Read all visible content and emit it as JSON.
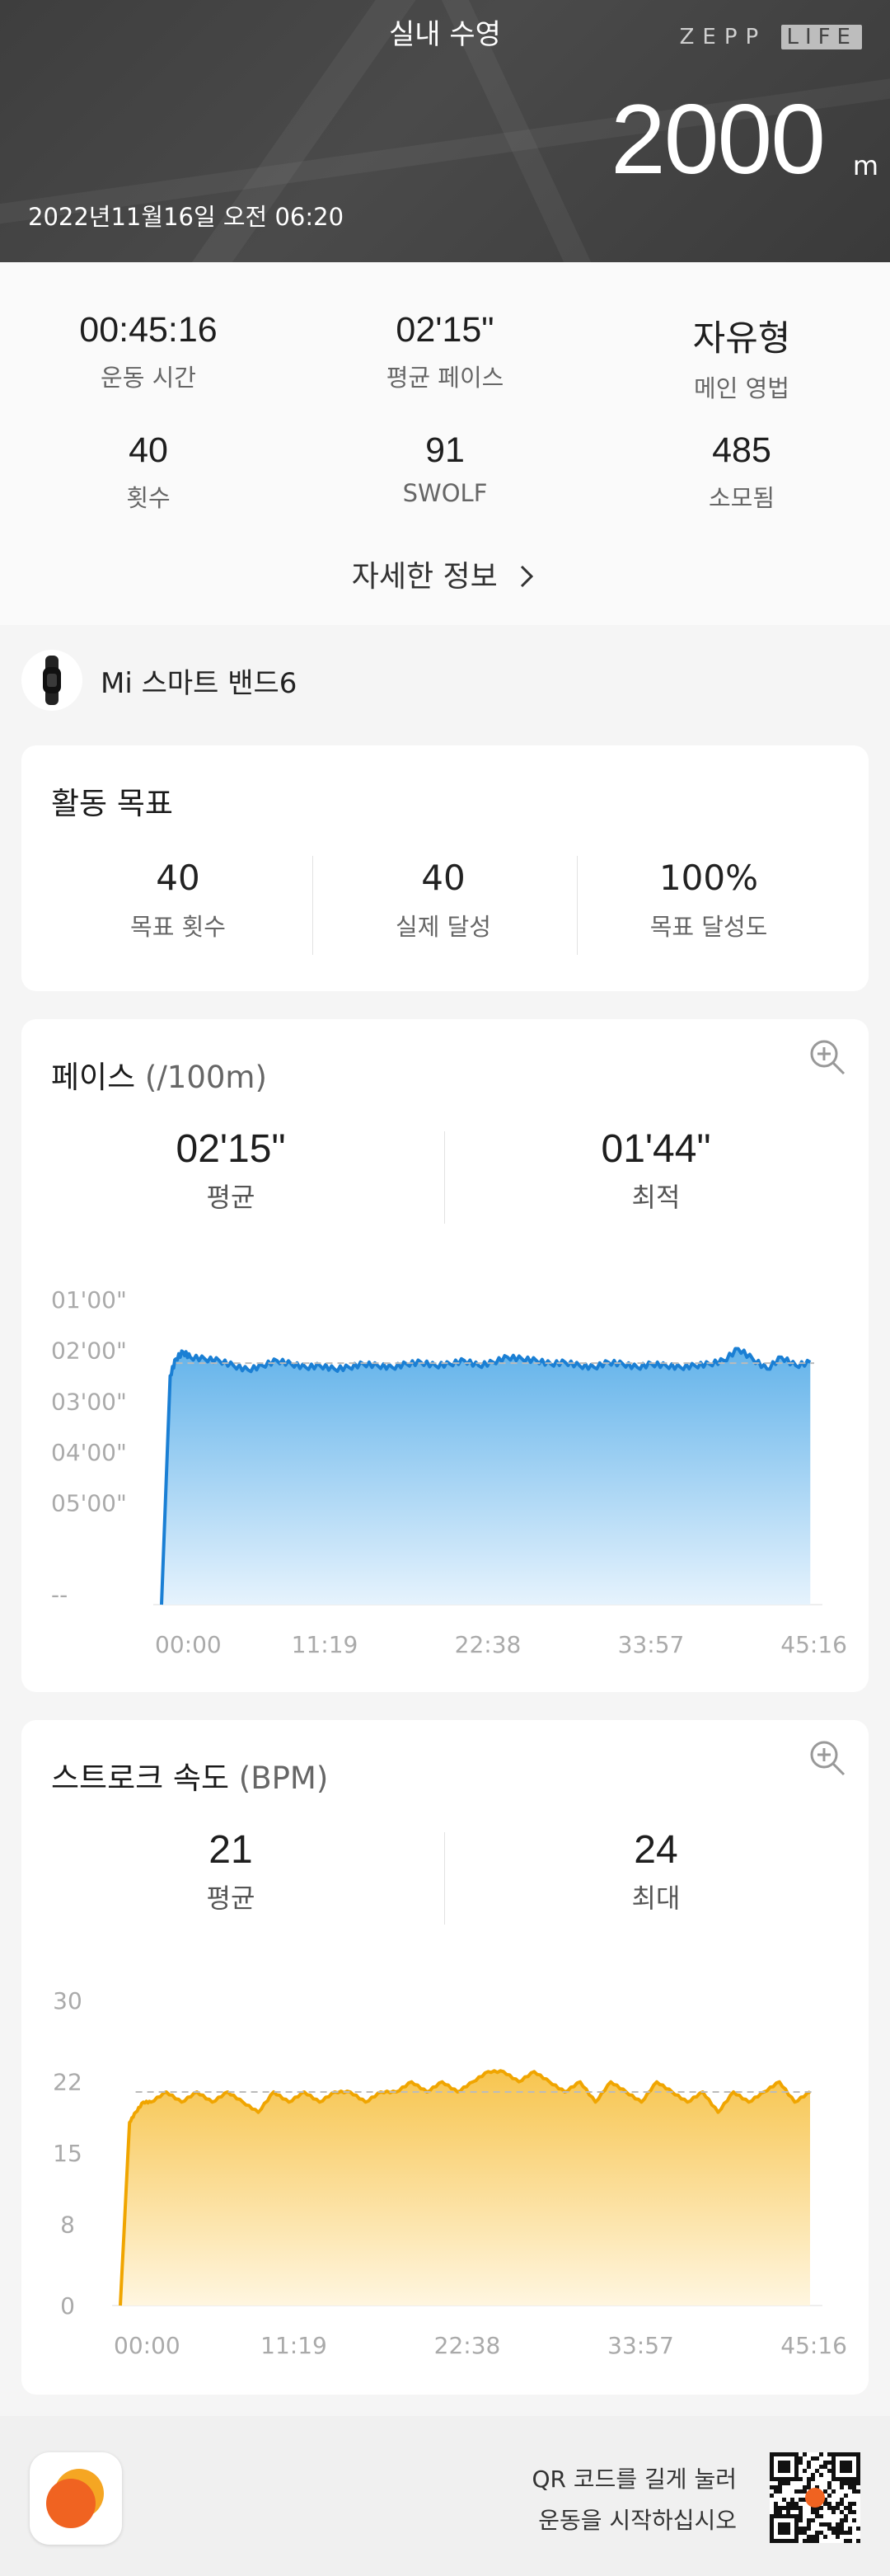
{
  "header": {
    "title": "실내 수영",
    "brand_left": "ZEPP",
    "brand_right": "LIFE",
    "distance": "2000",
    "distance_unit": "m",
    "datetime": "2022년11월16일 오전 06:20"
  },
  "summary": {
    "stats": [
      {
        "value": "00:45:16",
        "label": "운동 시간"
      },
      {
        "value": "02'15\"",
        "label": "평균 페이스"
      },
      {
        "value": "자유형",
        "label": "메인 영법"
      },
      {
        "value": "40",
        "label": "횟수"
      },
      {
        "value": "91",
        "label": "SWOLF"
      },
      {
        "value": "485",
        "label": "소모됨"
      }
    ],
    "more_label": "자세한 정보"
  },
  "device": {
    "name": "Mi 스마트 밴드6"
  },
  "goal": {
    "title": "활동 목표",
    "items": [
      {
        "value": "40",
        "label": "목표 횟수"
      },
      {
        "value": "40",
        "label": "실제 달성"
      },
      {
        "value": "100%",
        "label": "목표 달성도"
      }
    ]
  },
  "pace": {
    "title": "페이스",
    "unit": "(/100m)",
    "avg_value": "02'15\"",
    "avg_label": "평균",
    "best_value": "01'44\"",
    "best_label": "최적"
  },
  "stroke": {
    "title": "스트로크 속도",
    "unit": "(BPM)",
    "avg_value": "21",
    "avg_label": "평균",
    "max_value": "24",
    "max_label": "최대"
  },
  "footer": {
    "qr_line1": "QR 코드를 길게 눌러",
    "qr_line2": "운동을 시작하십시오"
  },
  "colors": {
    "pace_line": "#1a7fd4",
    "stroke_line": "#f0a500"
  },
  "chart_data": [
    {
      "type": "area",
      "x_ticks": [
        "00:00",
        "11:19",
        "22:38",
        "33:57",
        "45:16"
      ],
      "y_ticks": [
        "01'00\"",
        "02'00\"",
        "03'00\"",
        "04'00\"",
        "05'00\"",
        "--"
      ],
      "y_unit": "sec/100m",
      "y_inverted": true,
      "ylim": [
        60,
        420
      ],
      "xlim": [
        0,
        45.27
      ],
      "average_line": 135,
      "x": [
        0,
        0.6,
        1,
        1.5,
        2,
        3,
        4,
        5,
        6,
        7,
        8,
        9,
        10,
        11,
        12,
        13,
        14,
        15,
        16,
        17,
        18,
        19,
        20,
        21,
        22,
        23,
        24,
        25,
        26,
        27,
        28,
        29,
        30,
        31,
        32,
        33,
        34,
        35,
        36,
        37,
        38,
        39,
        40,
        41,
        42,
        43,
        44,
        45
      ],
      "y": [
        420,
        150,
        130,
        122,
        128,
        130,
        132,
        138,
        143,
        138,
        132,
        136,
        140,
        138,
        142,
        140,
        136,
        138,
        140,
        136,
        134,
        138,
        136,
        132,
        138,
        134,
        128,
        130,
        132,
        136,
        134,
        138,
        140,
        134,
        136,
        140,
        136,
        138,
        140,
        138,
        136,
        132,
        118,
        130,
        142,
        128,
        138,
        134
      ]
    },
    {
      "type": "area",
      "x_ticks": [
        "00:00",
        "11:19",
        "22:38",
        "33:57",
        "45:16"
      ],
      "y_ticks": [
        "30",
        "22",
        "15",
        "8",
        "0"
      ],
      "ylim": [
        0,
        30
      ],
      "xlim": [
        0,
        45.27
      ],
      "average_line": 21,
      "x": [
        0,
        0.6,
        1,
        1.5,
        2,
        3,
        4,
        5,
        6,
        7,
        8,
        9,
        10,
        11,
        12,
        13,
        14,
        15,
        16,
        17,
        18,
        19,
        20,
        21,
        22,
        23,
        24,
        25,
        26,
        27,
        28,
        29,
        30,
        31,
        32,
        33,
        34,
        35,
        36,
        37,
        38,
        39,
        40,
        41,
        42,
        43,
        44,
        45
      ],
      "y": [
        0,
        18,
        19,
        20,
        20,
        21,
        20,
        21,
        20,
        21,
        20,
        19,
        21,
        20,
        21,
        20,
        21,
        21,
        20,
        21,
        21,
        22,
        21,
        22,
        21,
        22,
        23,
        23,
        22,
        23,
        22,
        21,
        22,
        20,
        22,
        21,
        20,
        22,
        21,
        20,
        21,
        19,
        21,
        20,
        21,
        22,
        20,
        21
      ]
    }
  ]
}
